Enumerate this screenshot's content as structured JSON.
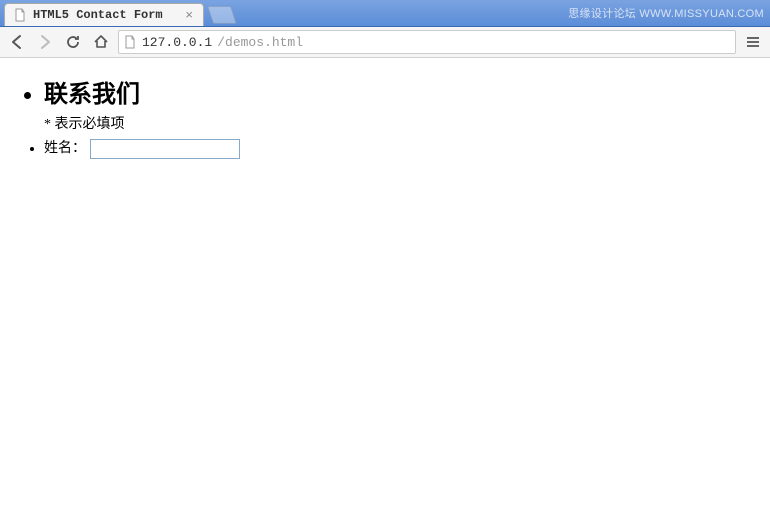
{
  "browser": {
    "tab_title": "HTML5 Contact Form",
    "url_host": "127.0.0.1",
    "url_path": "/demos.html"
  },
  "watermark": {
    "brand": "思缘设计论坛",
    "url": "WWW.MISSYUAN.COM"
  },
  "page": {
    "heading": "联系我们",
    "required_note": "* 表示必填项",
    "name_label": "姓名：",
    "name_value": ""
  }
}
